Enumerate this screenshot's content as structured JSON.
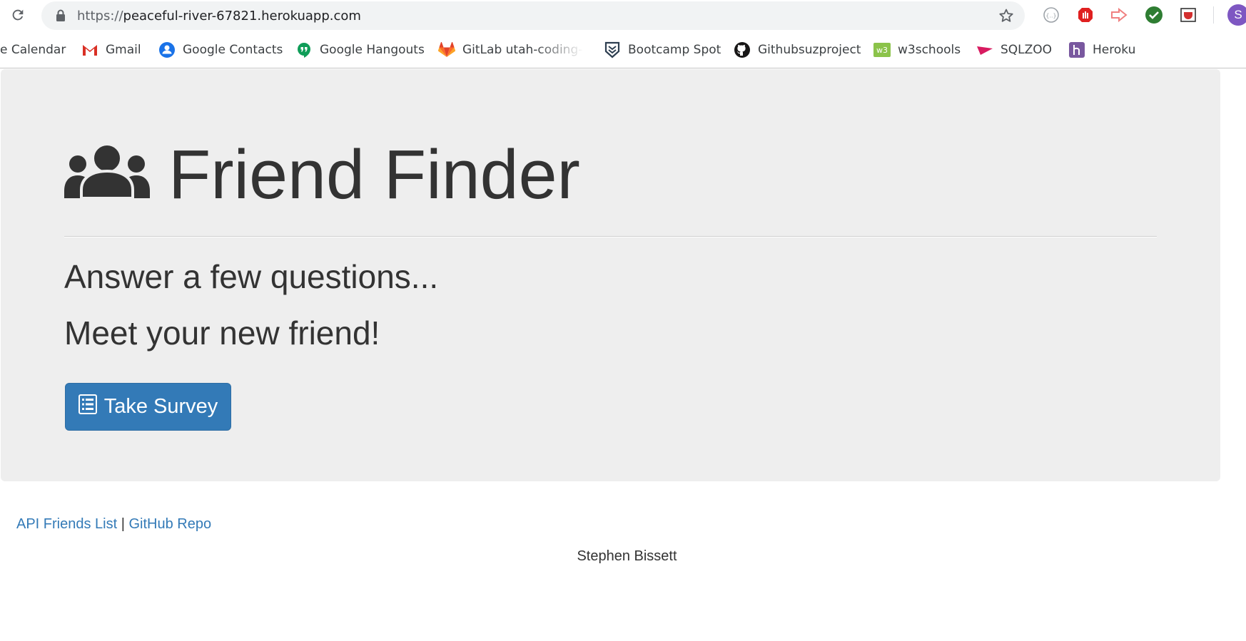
{
  "browser": {
    "url_prefix": "https://",
    "url_host": "peaceful-river-67821.herokuapp.com",
    "profile_initial": "S",
    "bookmarks": [
      {
        "label": "e Calendar",
        "icon": "calendar-icon"
      },
      {
        "label": "Gmail",
        "icon": "gmail-icon"
      },
      {
        "label": "Google Contacts",
        "icon": "contacts-icon"
      },
      {
        "label": "Google Hangouts",
        "icon": "hangouts-icon"
      },
      {
        "label": "GitLab utah-coding-b",
        "icon": "gitlab-icon"
      },
      {
        "label": "Bootcamp Spot",
        "icon": "bootcamp-icon"
      },
      {
        "label": "Githubsuzproject",
        "icon": "github-icon"
      },
      {
        "label": "w3schools",
        "icon": "w3schools-icon"
      },
      {
        "label": "SQLZOO",
        "icon": "sqlzoo-icon"
      },
      {
        "label": "Heroku",
        "icon": "heroku-icon"
      }
    ]
  },
  "page": {
    "title": "Friend Finder",
    "lead_1": "Answer a few questions...",
    "lead_2": "Meet your new friend!",
    "survey_button": "Take Survey",
    "footer_link_api": "API Friends List",
    "footer_separator": "|",
    "footer_link_repo": "GitHub Repo",
    "author": "Stephen Bissett"
  },
  "colors": {
    "jumbotron_bg": "#eeeeee",
    "primary": "#337ab7",
    "text": "#333333"
  }
}
